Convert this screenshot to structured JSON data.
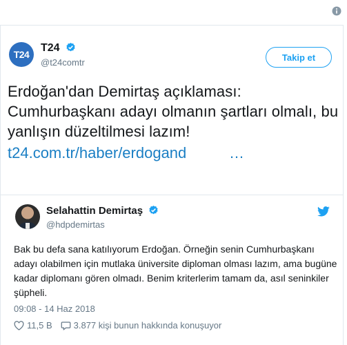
{
  "tweet": {
    "author_name": "T24",
    "author_handle": "@t24comtr",
    "avatar_text": "T24",
    "follow_label": "Takip et",
    "text": "Erdoğan'dan Demirtaş açıklaması: Cumhurbaşkanı adayı olmanın şartları olmalı, bu yanlışın düzeltilmesi lazım!",
    "link": "t24.com.tr/haber/erdogand",
    "link_ellipsis": "…"
  },
  "quote": {
    "author_name": "Selahattin Demirtaş",
    "author_handle": "@hdpdemirtas",
    "text": "Bak bu defa sana katılıyorum Erdoğan. Örneğin senin Cumhurbaşkanı adayı olabilmen için mutlaka üniversite diploman olması lazım, ama bugüne kadar diplomanı gören olmadı. Benim kriterlerim tamam da, asıl seninkiler şüpheli.",
    "timestamp": "09:08 - 14 Haz 2018",
    "likes": "11,5 B",
    "discussion": "3.877 kişi bunun hakkında konuşuyor"
  },
  "colors": {
    "accent": "#1da1f2",
    "link": "#1b7fc4",
    "muted": "#657786",
    "t24_brand": "#2d6fc0"
  },
  "icons": [
    "info-icon",
    "verified-badge-icon",
    "twitter-bird-icon",
    "heart-icon",
    "comment-icon"
  ]
}
